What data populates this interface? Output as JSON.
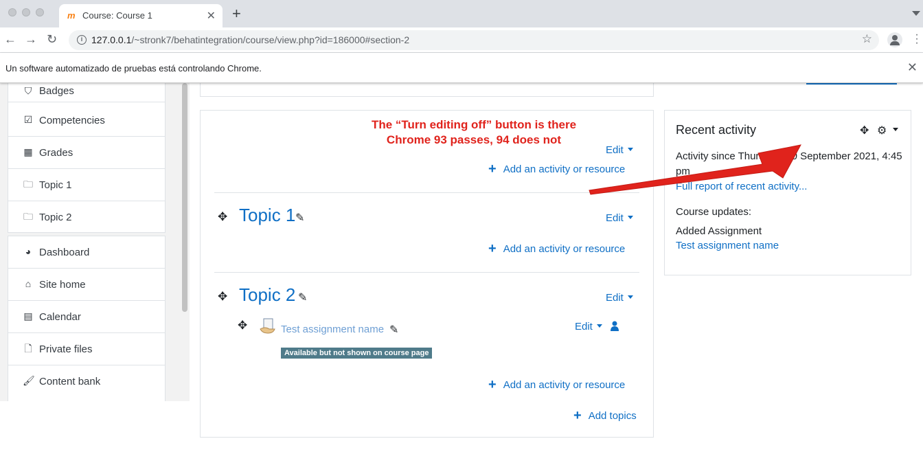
{
  "browser": {
    "tab_title": "Course: Course 1",
    "tab_favicon": "m",
    "new_tab_symbol": "+",
    "url_host": "127.0.0.1",
    "url_path": "/~stronk7/behatintegration/course/view.php?id=186000#section-2",
    "infobar_text": "Un software automatizado de pruebas está controlando Chrome."
  },
  "sidebar": {
    "group1": [
      {
        "label": "Badges",
        "icon": "shield-icon"
      },
      {
        "label": "Competencies",
        "icon": "checkbox-icon"
      },
      {
        "label": "Grades",
        "icon": "table-icon"
      },
      {
        "label": "Topic 1",
        "icon": "folder-icon"
      },
      {
        "label": "Topic 2",
        "icon": "folder-icon"
      }
    ],
    "group2": [
      {
        "label": "Dashboard",
        "icon": "dashboard-icon"
      },
      {
        "label": "Site home",
        "icon": "home-icon"
      },
      {
        "label": "Calendar",
        "icon": "calendar-icon"
      },
      {
        "label": "Private files",
        "icon": "file-icon"
      },
      {
        "label": "Content bank",
        "icon": "brush-icon"
      }
    ]
  },
  "main": {
    "annotation_line1": "The “Turn editing off” button is there",
    "annotation_line2": "Chrome 93 passes, 94 does not",
    "edit_label": "Edit",
    "add_activity_label": "Add an activity or resource",
    "add_topics_label": "Add topics",
    "sections": [
      {
        "title": "Topic 1"
      },
      {
        "title": "Topic 2"
      }
    ],
    "activity": {
      "name": "Test assignment name",
      "badge": "Available but not shown on course page"
    }
  },
  "recent_activity": {
    "title": "Recent activity",
    "since_text": "Activity since Thursday, 30 September 2021, 4:45 pm",
    "full_report_link": "Full report of recent activity...",
    "course_updates_label": "Course updates:",
    "added_label": "Added Assignment",
    "assignment_link": "Test assignment name"
  },
  "colors": {
    "link": "#0f6fc5",
    "annotation_red": "#e0231c",
    "badge_bg": "#4f7b8a"
  }
}
